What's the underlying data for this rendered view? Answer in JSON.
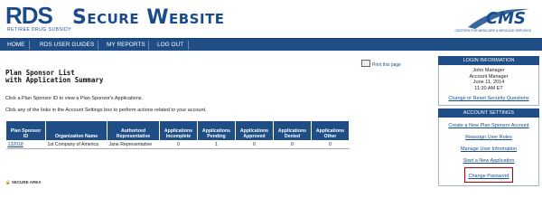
{
  "header": {
    "logo": "RDS",
    "logo_sub": "RETIREE DRUG SUBSIDY",
    "title": "Secure Website",
    "cms_logo": "CMS",
    "cms_sub": "CENTERS FOR MEDICARE & MEDICAID SERVICES"
  },
  "nav": {
    "items": [
      {
        "label": "HOME"
      },
      {
        "label": "RDS USER GUIDES"
      },
      {
        "label": "MY REPORTS"
      },
      {
        "label": "LOG OUT"
      }
    ]
  },
  "page": {
    "title_line1": "Plan Sponsor List",
    "title_line2": "with Application Summary",
    "print_label": "Print this page",
    "instruction1": "Click a Plan Sponsor ID to view a Plan Sponsor's Applications.",
    "instruction2": "Click any of the links in the Account Settings box to perform actions related to your account.",
    "secure_area": "SECURE AREA"
  },
  "table": {
    "headers": [
      "Plan Sponsor ID",
      "Organization Name",
      "Authorized Representative",
      "Applications Incomplete",
      "Applications Pending",
      "Applications Approved",
      "Applications Denied",
      "Applications Other"
    ],
    "rows": [
      {
        "id": "132018",
        "org": "1st Company of America",
        "rep": "Jane Representative",
        "incomplete": "0",
        "pending": "1",
        "approved": "0",
        "denied": "0",
        "other": "0"
      }
    ]
  },
  "login": {
    "heading": "LOGIN INFORMATION",
    "name": "John Manager",
    "role": "Account Manager",
    "date": "June 11, 2014",
    "time": "11:30 AM ET",
    "link": "Change or Reset Security Questions"
  },
  "account": {
    "heading": "ACCOUNT SETTINGS",
    "links": [
      {
        "label": "Create a New Plan Sponsor Account"
      },
      {
        "label": "Reassign User Roles"
      },
      {
        "label": "Manage User Information"
      },
      {
        "label": "Start a New Application"
      },
      {
        "label": "Change Password"
      }
    ]
  },
  "colors": {
    "brand": "#1f4e86",
    "highlight": "#c00000"
  }
}
